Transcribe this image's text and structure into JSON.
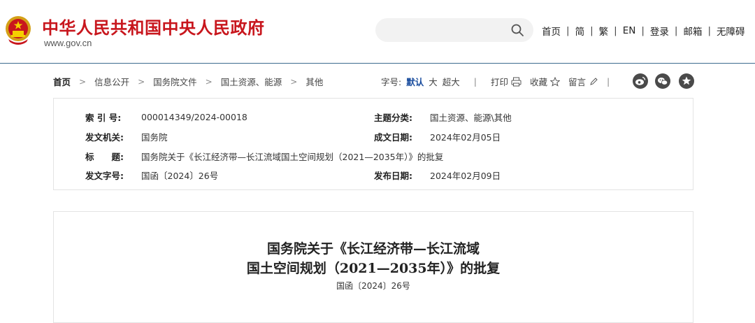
{
  "header": {
    "site_title": "中华人民共和国中央人民政府",
    "site_url": "www.gov.cn",
    "search_placeholder": "",
    "nav": [
      {
        "label": "首页"
      },
      {
        "label": "简"
      },
      {
        "label": "繁"
      },
      {
        "label": "EN"
      },
      {
        "label": "登录"
      },
      {
        "label": "邮箱"
      },
      {
        "label": "无障碍"
      }
    ]
  },
  "breadcrumb": [
    "首页",
    "信息公开",
    "国务院文件",
    "国土资源、能源",
    "其他"
  ],
  "tools": {
    "font_size_label": "字号:",
    "font_sizes": [
      "默认",
      "大",
      "超大"
    ],
    "print": "打印",
    "favorite": "收藏",
    "comment": "留言",
    "share_icons": [
      "weibo-icon",
      "wechat-icon",
      "star-icon"
    ]
  },
  "meta": {
    "index_label": "索 引 号:",
    "index_value": "000014349/2024-00018",
    "category_label": "主题分类:",
    "category_value": "国土资源、能源\\其他",
    "issuer_label": "发文机关:",
    "issuer_value": "国务院",
    "created_label": "成文日期:",
    "created_value": "2024年02月05日",
    "title_label": "标　　题:",
    "title_value": "国务院关于《长江经济带—长江流域国土空间规划（2021—2035年）》的批复",
    "docno_label": "发文字号:",
    "docno_value": "国函〔2024〕26号",
    "published_label": "发布日期:",
    "published_value": "2024年02月09日"
  },
  "article": {
    "title_line1": "国务院关于《长江经济带—长江流域",
    "title_line2": "国土空间规划（2021—2035年）》的批复",
    "doc_number": "国函〔2024〕26号"
  },
  "colors": {
    "brand_red": "#c8161d",
    "rule_blue": "#3d6b8e",
    "active_blue": "#1a4d9e"
  }
}
